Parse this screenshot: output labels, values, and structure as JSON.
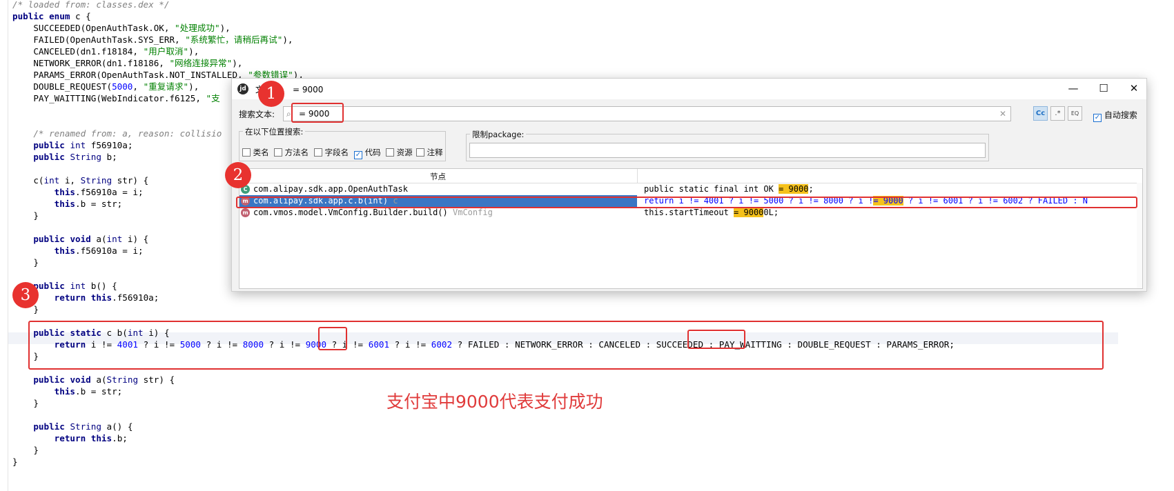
{
  "editor": {
    "lines": [
      "/* loaded from: classes.dex */",
      "public enum c {",
      "    SUCCEEDED(OpenAuthTask.OK, \"处理成功\"),",
      "    FAILED(OpenAuthTask.SYS_ERR, \"系统繁忙，请稍后再试\"),",
      "    CANCELED(dn1.f18184, \"用户取消\"),",
      "    NETWORK_ERROR(dn1.f18186, \"网络连接异常\"),",
      "    PARAMS_ERROR(OpenAuthTask.NOT_INSTALLED, \"参数错误\"),",
      "    DOUBLE_REQUEST(5000, \"重复请求\"),",
      "    PAY_WAITTING(WebIndicator.f6125, \"支",
      "",
      "",
      "    /* renamed from: a, reason: collisio",
      "    public int f56910a;",
      "    public String b;",
      "",
      "    c(int i, String str) {",
      "        this.f56910a = i;",
      "        this.b = str;",
      "    }",
      "",
      "    public void a(int i) {",
      "        this.f56910a = i;",
      "    }",
      "",
      "    public int b() {",
      "        return this.f56910a;",
      "    }",
      "",
      "    public static c b(int i) {",
      "        return i != 4001 ? i != 5000 ? i != 8000 ? i != 9000 ? i != 6001 ? i != 6002 ? FAILED : NETWORK_ERROR : CANCELED : SUCCEEDED : PAY_WAITTING : DOUBLE_REQUEST : PARAMS_ERROR;",
      "    }",
      "",
      "    public void a(String str) {",
      "        this.b = str;",
      "    }",
      "",
      "    public String a() {",
      "        return this.b;",
      "    }",
      "}"
    ]
  },
  "badges": {
    "one": "1",
    "two": "2",
    "three": "3"
  },
  "annotation": "支付宝中9000代表支付成功",
  "dialog": {
    "title_prefix": "文",
    "title_suffix": "= 9000",
    "window_buttons": {
      "minimize": "—",
      "maximize": "☐",
      "close": "✕"
    },
    "search_label": "搜索文本:",
    "search_value": "= 9000",
    "tools": {
      "case": "Cc",
      "regex": ".*",
      "word": "EQ"
    },
    "auto_search_label": "自动搜索",
    "auto_search_checked": true,
    "scope_label": "在以下位置搜索:",
    "scope_options": [
      {
        "label": "类名",
        "checked": false
      },
      {
        "label": "方法名",
        "checked": false
      },
      {
        "label": "字段名",
        "checked": false
      },
      {
        "label": "代码",
        "checked": true
      },
      {
        "label": "资源",
        "checked": false
      },
      {
        "label": "注释",
        "checked": false
      }
    ],
    "package_label": "限制package:",
    "package_value": "",
    "results_header": "节点",
    "results": [
      {
        "icon": "C",
        "node": "com.alipay.sdk.app.OpenAuthTask",
        "node_type": "",
        "code_before": "public static final int OK ",
        "code_match": "= 9000",
        "code_after": ";"
      },
      {
        "icon": "m",
        "node": "com.alipay.sdk.app.c.b(int)",
        "node_type": "c",
        "code_before": "return i != 4001 ? i != 5000 ? i != 8000 ? i !",
        "code_match": "= 9000",
        "code_after": " ? i != 6001 ? i != 6002 ? FAILED : N"
      },
      {
        "icon": "m",
        "node": "com.vmos.model.VmConfig.Builder.build()",
        "node_type": "VmConfig",
        "code_before": "this.startTimeout ",
        "code_match": "= 9000",
        "code_after": "0L;"
      }
    ]
  },
  "colors": {
    "accent_red": "#e03030",
    "selection_blue": "#3a76c4",
    "match_yellow": "#f5c11b"
  }
}
